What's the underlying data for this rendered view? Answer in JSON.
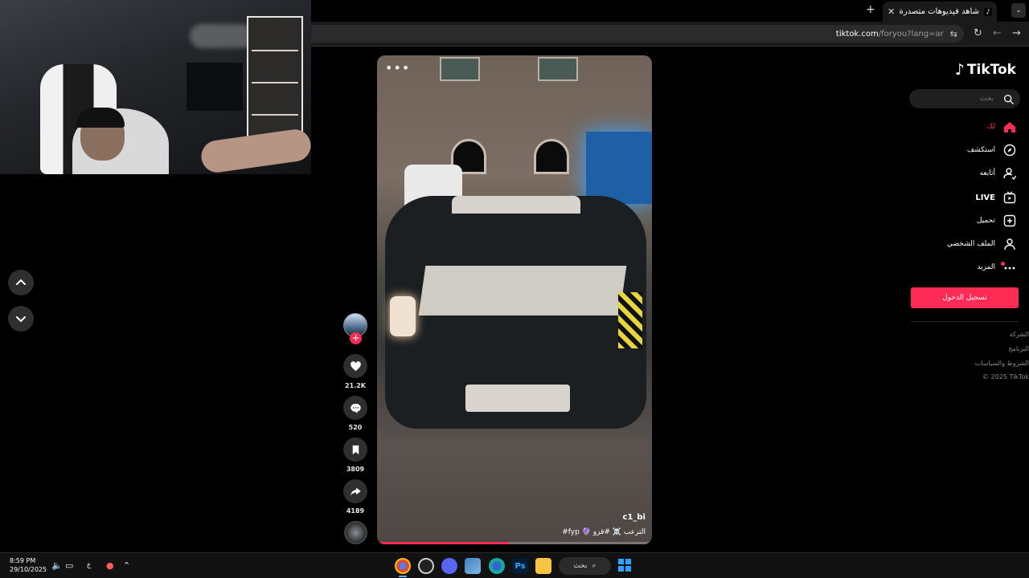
{
  "browser": {
    "tab_title": "شاهد فيديوهات متصدرة | TikTok",
    "tab_close": "✕",
    "new_tab": "+",
    "url_host": "tiktok.com",
    "url_path": "/foryou?lang=ar"
  },
  "video": {
    "username": "c1_bi",
    "caption": "الترعب ☠️ #قزو 🔮 fyp#",
    "progress": 0.48
  },
  "actions": {
    "likes": "21.2K",
    "comments": "520",
    "saves": "3809",
    "shares": "4189",
    "follow": "+"
  },
  "sidebar": {
    "logo": "TikTok",
    "search_placeholder": "بحث",
    "items": [
      {
        "label": "لك",
        "icon": "home-icon"
      },
      {
        "label": "استكشف",
        "icon": "compass-icon"
      },
      {
        "label": "أتابعه",
        "icon": "following-icon"
      },
      {
        "label": "LIVE",
        "icon": "live-icon"
      },
      {
        "label": "تحميل",
        "icon": "upload-icon"
      },
      {
        "label": "الملف الشخصي",
        "icon": "profile-icon"
      },
      {
        "label": "المزيد",
        "icon": "more-icon"
      }
    ],
    "login": "تسجيل الدخول",
    "footer": [
      "الشركة",
      "البرنامج",
      "الشروط والسياسات"
    ],
    "copyright": "© 2025 TikTok"
  },
  "taskbar": {
    "time": "8:59 PM",
    "date": "29/10/2025",
    "lang": "ع",
    "search": "بحث"
  },
  "colors": {
    "accent": "#fe2c55",
    "background": "#000000"
  }
}
